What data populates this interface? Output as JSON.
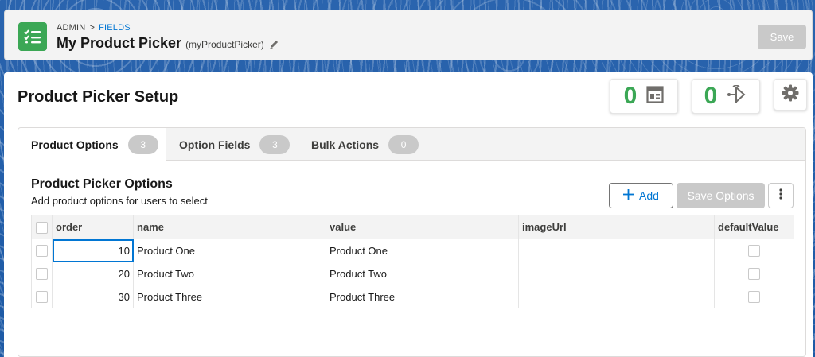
{
  "header": {
    "breadcrumb": {
      "root": "ADMIN",
      "separator": ">",
      "current": "FIELDS"
    },
    "title": "My Product Picker",
    "api_name": "(myProductPicker)",
    "save_label": "Save",
    "app_icon": "list-check-icon",
    "edit_icon": "pencil-icon"
  },
  "setup": {
    "title": "Product Picker Setup",
    "metrics": [
      {
        "value": "0",
        "icon": "layout-icon"
      },
      {
        "value": "0",
        "icon": "flow-icon"
      }
    ],
    "settings_icon": "gear-icon"
  },
  "tabs": [
    {
      "label": "Product Options",
      "count": "3",
      "active": true
    },
    {
      "label": "Option Fields",
      "count": "3",
      "active": false
    },
    {
      "label": "Bulk Actions",
      "count": "0",
      "active": false
    }
  ],
  "options": {
    "title": "Product Picker Options",
    "subtitle": "Add product options for users to select",
    "add_label": "Add",
    "save_label": "Save Options",
    "more_icon": "kebab-menu-icon"
  },
  "table": {
    "columns": [
      "order",
      "name",
      "value",
      "imageUrl",
      "defaultValue"
    ],
    "rows": [
      {
        "order": "10",
        "name": "Product One",
        "value": "Product One",
        "imageUrl": "",
        "defaultValue": false
      },
      {
        "order": "20",
        "name": "Product Two",
        "value": "Product Two",
        "imageUrl": "",
        "defaultValue": false
      },
      {
        "order": "30",
        "name": "Product Three",
        "value": "Product Three",
        "imageUrl": "",
        "defaultValue": false
      }
    ]
  },
  "colors": {
    "brand_blue": "#0176d3",
    "success_green": "#3ba755",
    "disabled_gray": "#c9c9c9"
  }
}
